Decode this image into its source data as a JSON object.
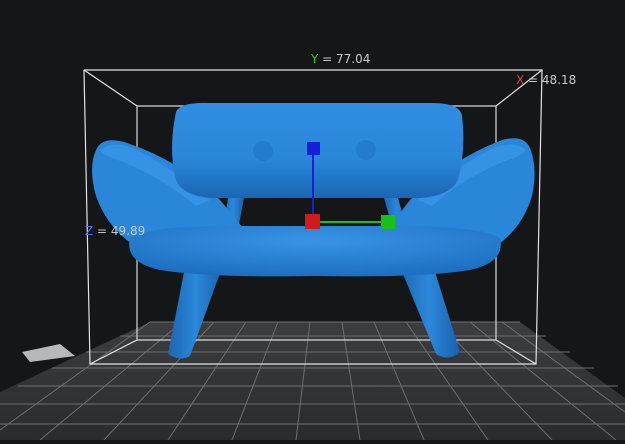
{
  "viewport": {
    "background": "#151617",
    "bed_color": "#3a3b3d",
    "grid_color": "#6d6e70",
    "model_color": "#2a86d8",
    "bbox_color": "#d8d8d8"
  },
  "dimensions": {
    "y": {
      "axis": "Y",
      "sep": " = ",
      "value": "77.04",
      "color": "#35d135"
    },
    "x": {
      "axis": "X",
      "sep": " = ",
      "value": "48.18",
      "color": "#e04040"
    },
    "z": {
      "axis": "Z",
      "sep": " = ",
      "value": "49.89",
      "color": "#5a6cf0"
    }
  },
  "gizmo": {
    "x_color": "#d11a1a",
    "y_color": "#17c217",
    "z_color": "#1420d8"
  },
  "icons": [
    "move-gizmo-icon"
  ]
}
